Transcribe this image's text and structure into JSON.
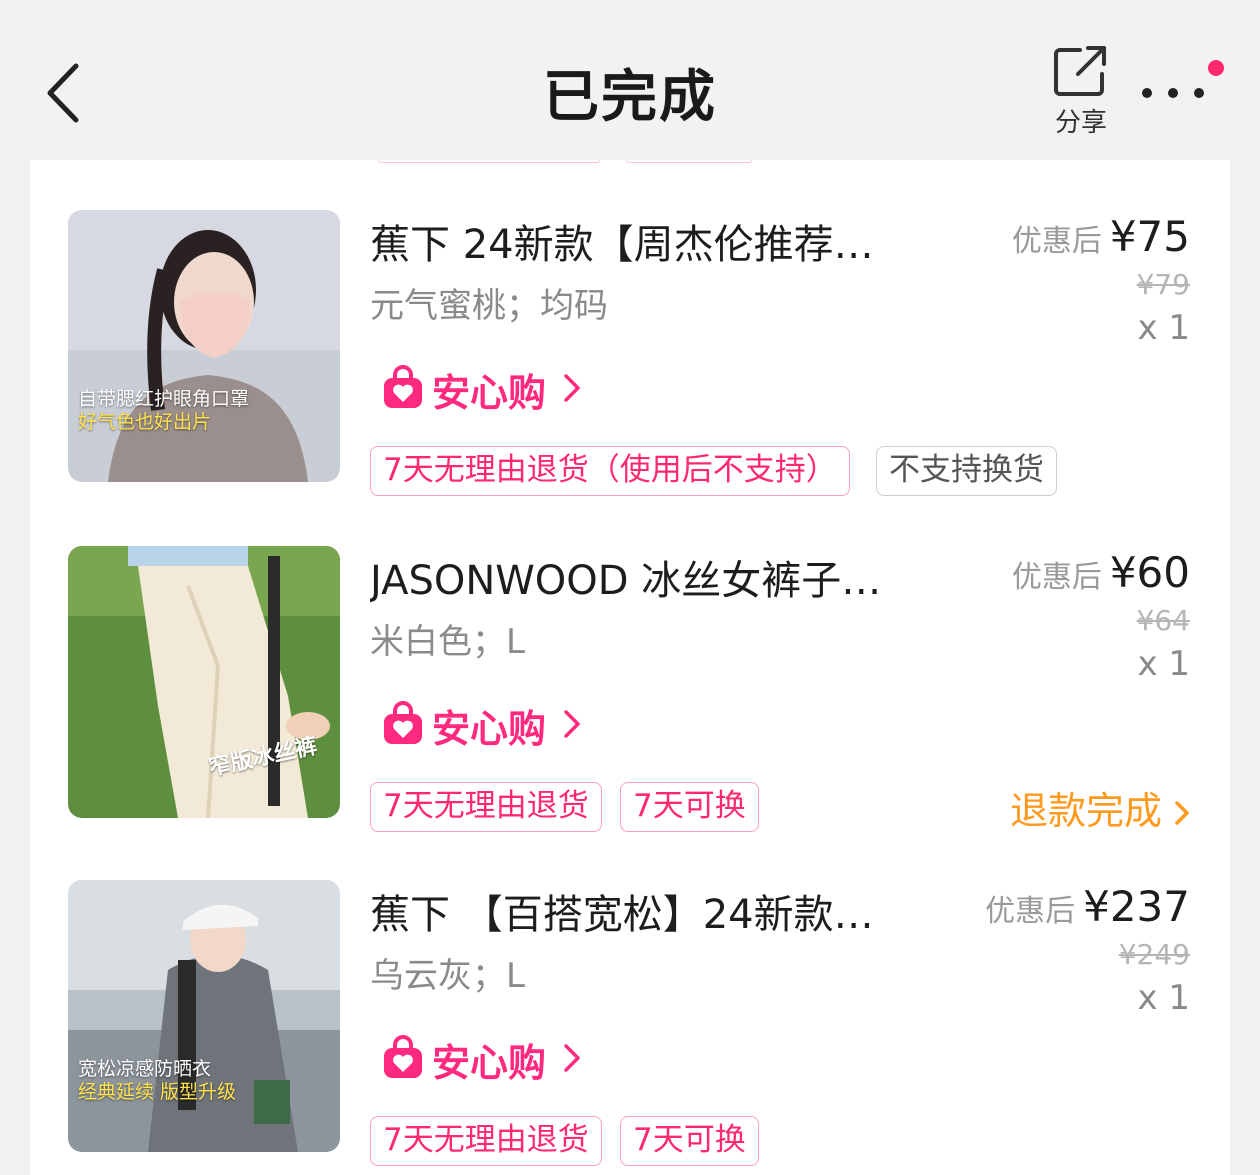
{
  "header": {
    "title": "已完成",
    "share_label": "分享"
  },
  "assure_label": "安心购",
  "price_prefix": "优惠后",
  "products": [
    {
      "title": "蕉下 24新款【周杰伦推荐…",
      "spec": "元气蜜桃；均码",
      "price": "¥75",
      "original_price": "¥79",
      "quantity": "x 1",
      "image_caption": [
        "自带腮红护眼角口罩",
        "好气色也好出片"
      ],
      "tags": [
        "7天无理由退货（使用后不支持）",
        "不支持换货"
      ]
    },
    {
      "title": "JASONWOOD 冰丝女裤子…",
      "spec": "米白色；L",
      "price": "¥60",
      "original_price": "¥64",
      "quantity": "x 1",
      "image_caption": [
        "窄版冰丝裤"
      ],
      "tags": [
        "7天无理由退货",
        "7天可换"
      ],
      "refund_status": "退款完成"
    },
    {
      "title": "蕉下 【百搭宽松】24新款…",
      "spec": "乌云灰；L",
      "price": "¥237",
      "original_price": "¥249",
      "quantity": "x 1",
      "image_caption": [
        "宽松凉感防晒衣",
        "经典延续 版型升级"
      ],
      "tags": [
        "7天无理由退货",
        "7天可换"
      ]
    }
  ],
  "colors": {
    "accent_pink": "#ff2a7f",
    "refund_orange": "#ff9a1f",
    "notify_dot": "#ff2a6d"
  }
}
